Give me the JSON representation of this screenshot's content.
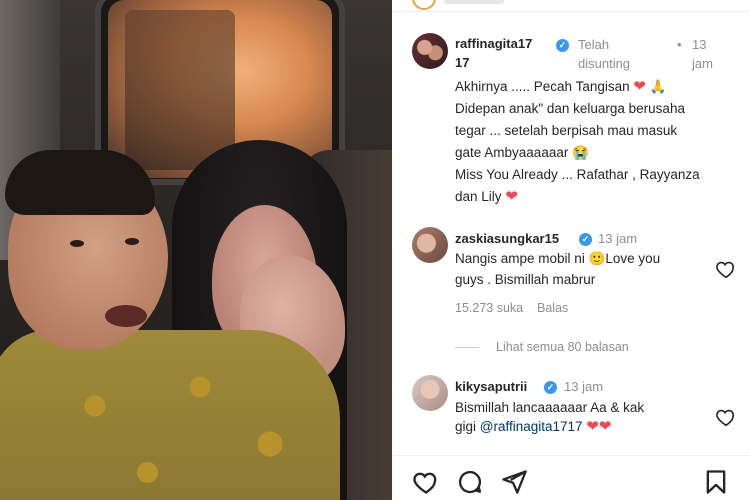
{
  "post": {
    "author": "raffinagita17",
    "author_suffix": "17",
    "edited_label": "Telah",
    "edited_label2": "disunting",
    "time_dot": "•",
    "time": "13",
    "time_unit": "jam",
    "caption_lines": [
      "Akhirnya ..... Pecah Tangisan",
      "Didepan anak\" dan keluarga berusaha",
      "tegar ... setelah berpisah mau masuk",
      "gate Ambyaaaaaar",
      "Miss You Already ... Rafathar , Rayyanza",
      "dan Lily"
    ],
    "emoji": {
      "heart": "❤",
      "pray": "🙏",
      "cry": "😭"
    }
  },
  "comments": [
    {
      "user": "zaskiasungkar15",
      "time": "13 jam",
      "lines": [
        "Nangis ampe mobil ni 🙂Love you",
        "guys . Bismillah mabrur"
      ],
      "likes": "15.273 suka",
      "reply_label": "Balas"
    },
    {
      "user": "kikysaputrii",
      "time": "13 jam",
      "lines": [
        "Bismillah lancaaaaaar Aa & kak",
        "gigi"
      ],
      "mention": "@raffinagita1717"
    }
  ],
  "view_replies": "Lihat semua 80 balasan",
  "icons": {
    "verified": "verified-badge-icon",
    "like": "heart-outline-icon",
    "comment": "comment-icon",
    "share": "paper-plane-icon",
    "save": "bookmark-icon"
  },
  "colors": {
    "verified": "#3897f0",
    "heart": "#ed4956",
    "muted": "#8e8e8e",
    "mention": "#00376b"
  }
}
